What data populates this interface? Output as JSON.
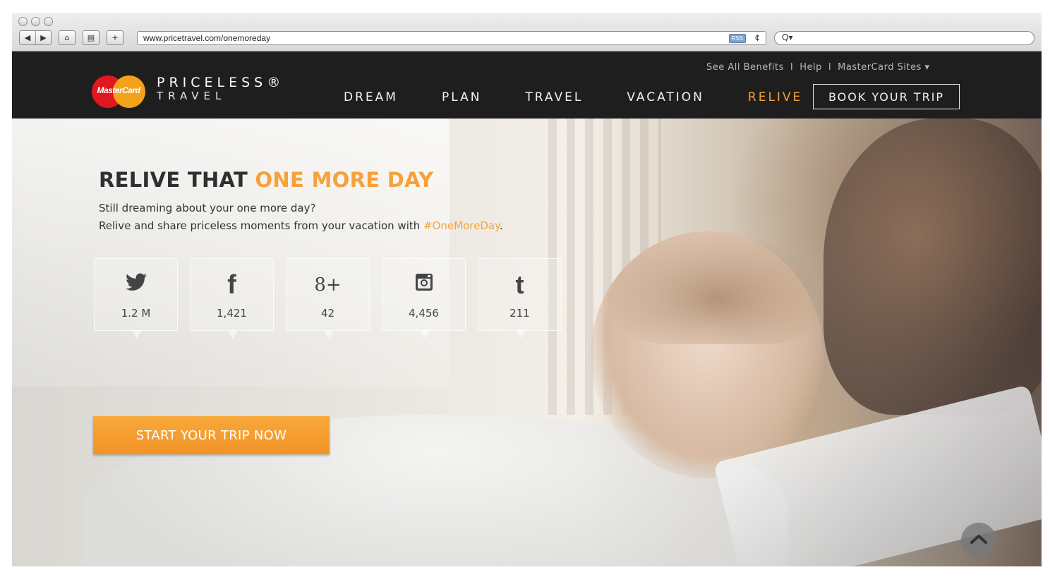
{
  "browser": {
    "url": "www.pricetravel.com/onemoreday",
    "rss_label": "RSS",
    "reload_glyph": "¢",
    "search_glyph": "Q▾"
  },
  "header": {
    "brand_line1": "PRICELESS®",
    "brand_line2": "TRAVEL",
    "logo_word": "MasterCard",
    "top_links": [
      "See All Benefits",
      "Help",
      "MasterCard Sites ▾"
    ],
    "nav": [
      {
        "label": "DREAM",
        "active": false
      },
      {
        "label": "PLAN",
        "active": false
      },
      {
        "label": "TRAVEL",
        "active": false
      },
      {
        "label": "VACATION",
        "active": false
      },
      {
        "label": "RELIVE",
        "active": true
      }
    ],
    "book_label": "BOOK YOUR TRIP"
  },
  "hero": {
    "title_main": "RELIVE THAT ",
    "title_accent": "ONE MORE DAY",
    "sub_line1": "Still dreaming about your one more day?",
    "sub_line2_pre": "Relive and share priceless moments from your vacation with ",
    "sub_hashtag": "#OneMoreDay",
    "sub_line2_post": ".",
    "cta_label": "START YOUR TRIP NOW"
  },
  "socials": [
    {
      "icon": "twitter-icon",
      "glyph": "🐦",
      "count": "1.2 M"
    },
    {
      "icon": "facebook-icon",
      "glyph": "f",
      "count": "1,421"
    },
    {
      "icon": "google-plus-icon",
      "glyph": "8+",
      "count": "42"
    },
    {
      "icon": "instagram-icon",
      "glyph": "◙",
      "count": "4,456"
    },
    {
      "icon": "tumblr-icon",
      "glyph": "t",
      "count": "211"
    }
  ],
  "colors": {
    "accent": "#f6a13a",
    "header_bg": "#1e1e1e",
    "cta": "#f29428"
  }
}
